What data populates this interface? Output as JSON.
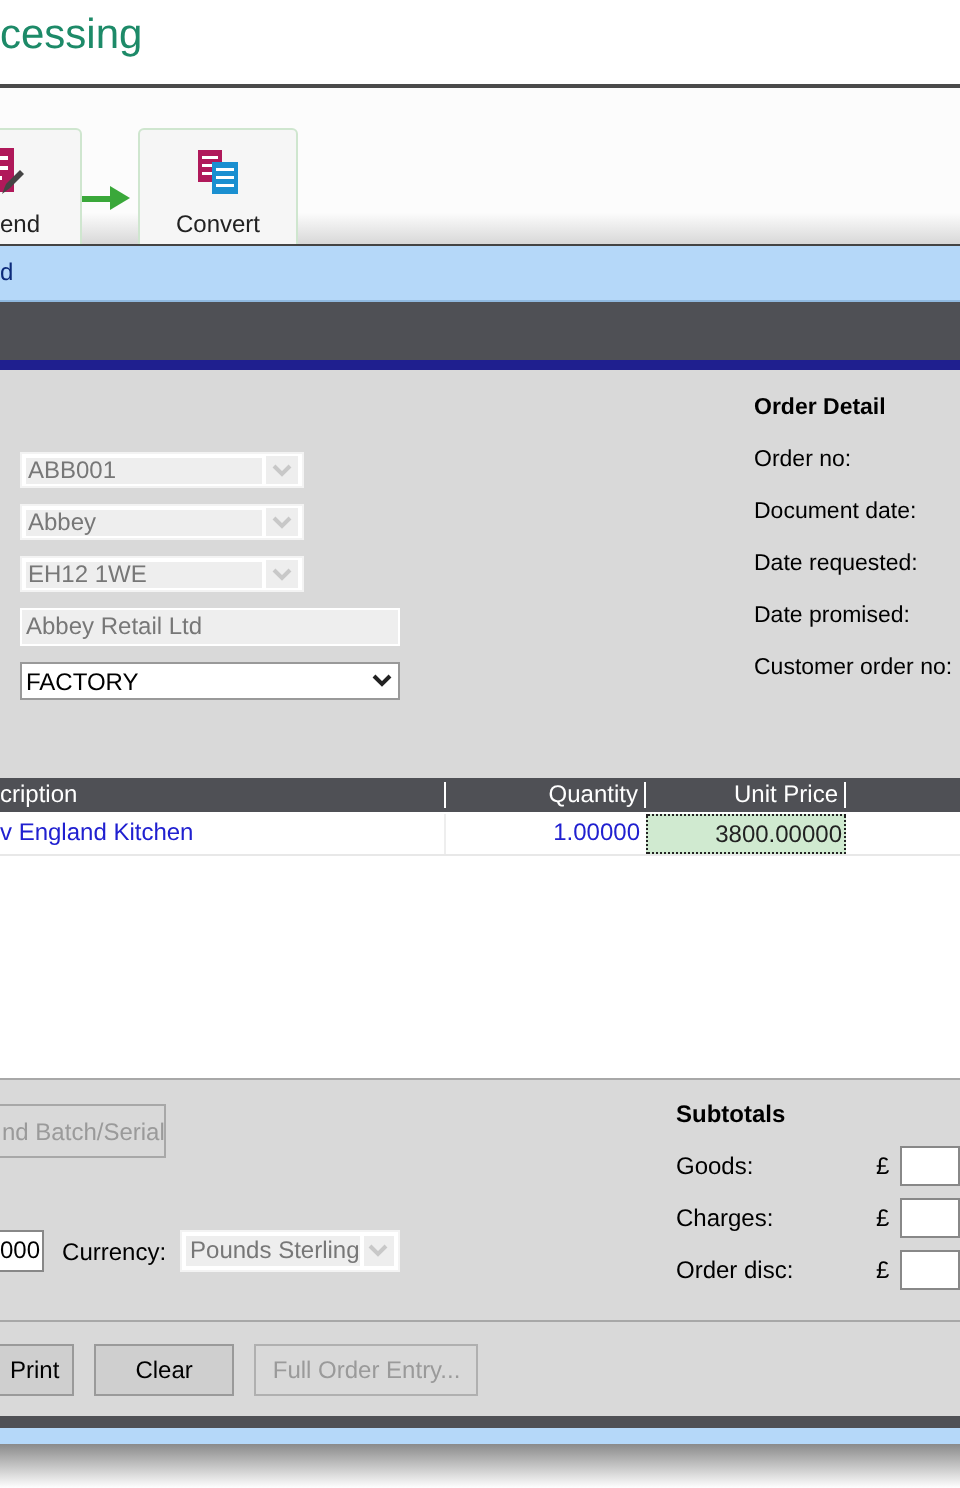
{
  "page_title": "cessing",
  "process_steps": [
    {
      "kind": "send",
      "label": "end"
    },
    {
      "kind": "convert",
      "label": "Convert"
    }
  ],
  "dialog": {
    "title": "d",
    "customer_fields": [
      {
        "kind": "combo",
        "value": "ABB001",
        "disabled": true
      },
      {
        "kind": "combo",
        "value": "Abbey",
        "disabled": true
      },
      {
        "kind": "combo",
        "value": "EH12 1WE",
        "disabled": true
      },
      {
        "kind": "text",
        "value": "Abbey Retail Ltd",
        "disabled": true
      },
      {
        "kind": "select",
        "value": "FACTORY",
        "disabled": false
      }
    ],
    "order_detail": {
      "heading": "Order Detail",
      "labels": [
        "Order no:",
        "Document date:",
        "Date requested:",
        "Date promised:",
        "Customer order no:"
      ]
    },
    "grid": {
      "columns": [
        "cription",
        "Quantity",
        "Unit Price"
      ],
      "rows": [
        {
          "description": "v England Kitchen",
          "quantity": "1.00000",
          "unit_price": "3800.00000",
          "unit_price_focused": true
        }
      ]
    },
    "batch_button": {
      "label": "nd Batch/Serial",
      "disabled": true
    },
    "exchange_rate": "000",
    "currency": {
      "label": "Currency:",
      "value": "Pounds Sterling",
      "disabled": true
    },
    "subtotals": {
      "heading": "Subtotals",
      "rows": [
        {
          "label": "Goods:",
          "symbol": "£"
        },
        {
          "label": "Charges:",
          "symbol": "£"
        },
        {
          "label": "Order disc:",
          "symbol": "£"
        }
      ]
    },
    "buttons": [
      {
        "label": "Print",
        "disabled": false
      },
      {
        "label": "Clear",
        "disabled": false
      },
      {
        "label": "Full Order Entry...",
        "disabled": true
      }
    ]
  }
}
